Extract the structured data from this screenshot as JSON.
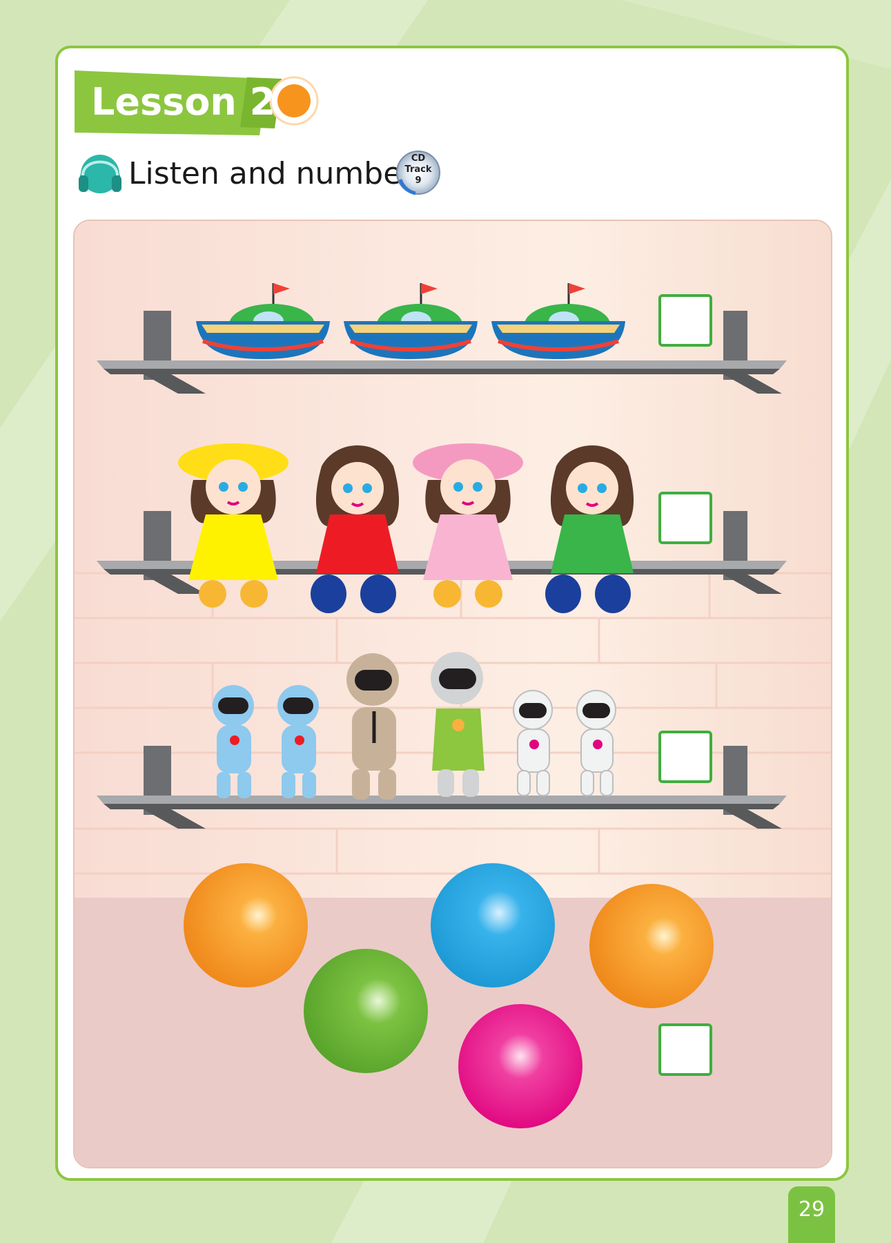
{
  "lesson": {
    "label": "Lesson 2"
  },
  "instruction": {
    "text": "Listen and number."
  },
  "cd": {
    "line1": "CD",
    "line2": "Track",
    "line3": "9"
  },
  "page": {
    "number": "29"
  },
  "rows": [
    {
      "item": "boat",
      "count": 3
    },
    {
      "item": "doll",
      "count": 4
    },
    {
      "item": "robot",
      "count": 6
    },
    {
      "item": "ball",
      "count": 5
    }
  ],
  "colors": {
    "accent_green": "#8cc63f",
    "box_green": "#3fae3f",
    "lesson_dot": "#f7941d",
    "headphone_teal": "#2bb7a9"
  }
}
